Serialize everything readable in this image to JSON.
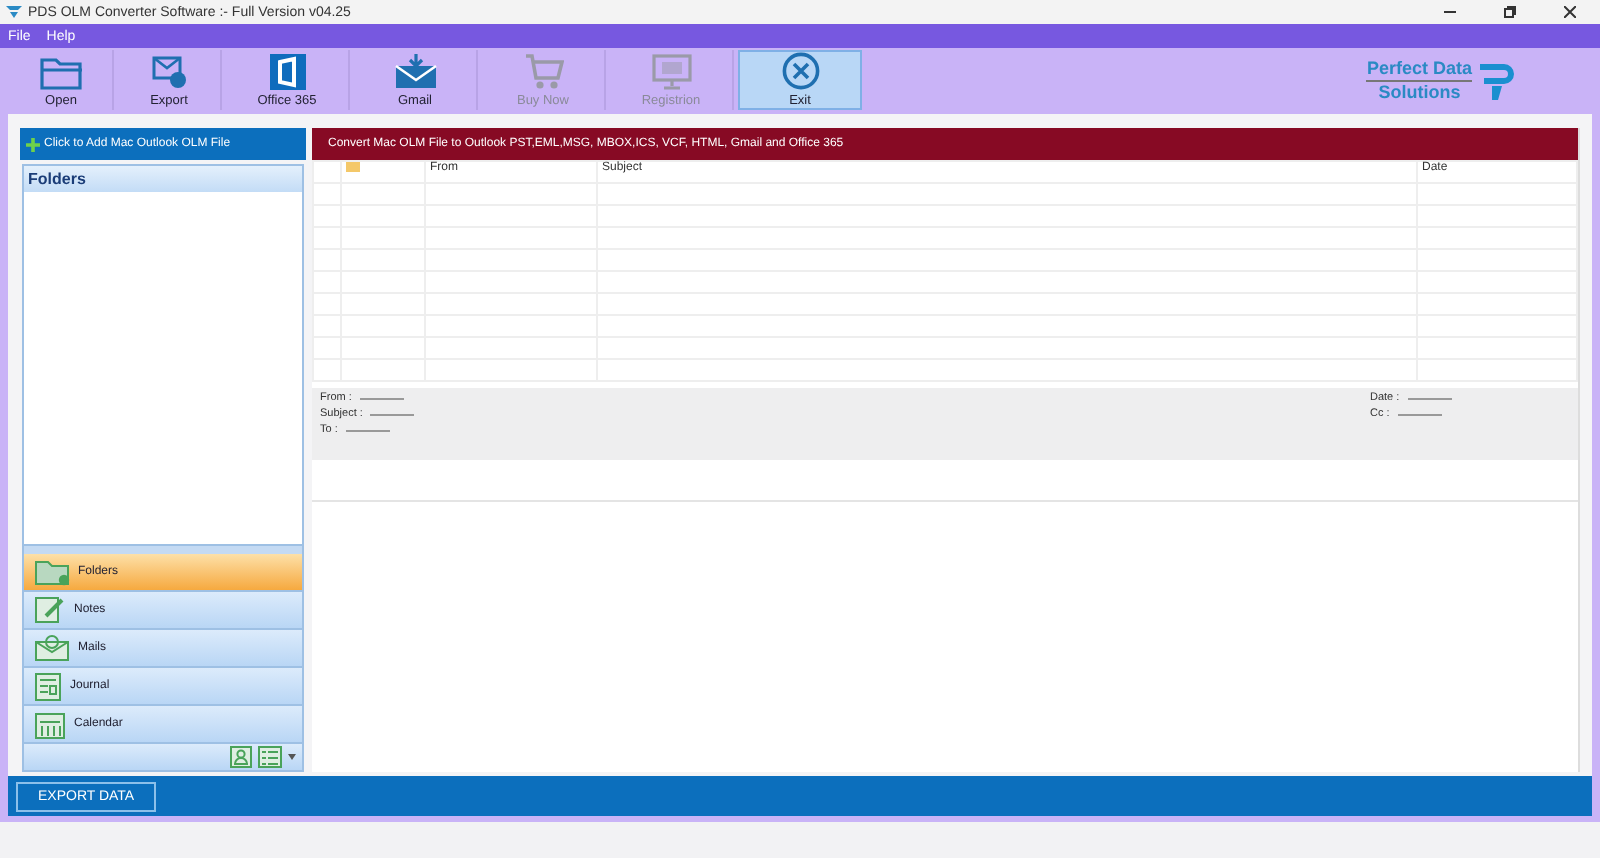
{
  "window": {
    "title": "PDS OLM Converter Software :- Full Version v04.25"
  },
  "menu": [
    "File",
    "Help"
  ],
  "toolbar": [
    {
      "label": "Open",
      "kind": "open",
      "disabled": false,
      "selected": false
    },
    {
      "label": "Export",
      "kind": "export",
      "disabled": false,
      "selected": false
    },
    {
      "label": "Office 365",
      "kind": "office",
      "disabled": false,
      "selected": false
    },
    {
      "label": "Gmail",
      "kind": "gmail",
      "disabled": false,
      "selected": false
    },
    {
      "label": "Buy Now",
      "kind": "cart",
      "disabled": true,
      "selected": false
    },
    {
      "label": "Registrion",
      "kind": "monitor",
      "disabled": true,
      "selected": false
    },
    {
      "label": "Exit",
      "kind": "exit",
      "disabled": false,
      "selected": true
    }
  ],
  "logo": {
    "line1": "Perfect Data",
    "line2": "Solutions"
  },
  "add_file_button": "Click to Add Mac Outlook OLM File",
  "folders_header": "Folders",
  "nav": [
    {
      "label": "Folders",
      "kind": "folder",
      "selected": true
    },
    {
      "label": "Notes",
      "kind": "notes",
      "selected": false
    },
    {
      "label": "Mails",
      "kind": "mail",
      "selected": false
    },
    {
      "label": "Journal",
      "kind": "journal",
      "selected": false
    },
    {
      "label": "Calendar",
      "kind": "calendar",
      "selected": false
    }
  ],
  "banner": "Convert Mac OLM File to Outlook PST,EML,MSG, MBOX,ICS, VCF, HTML, Gmail and Office 365",
  "table": {
    "columns": [
      "From",
      "Subject",
      "Date"
    ]
  },
  "preview": {
    "left": [
      "From :",
      "Subject :",
      "To :"
    ],
    "right": [
      "Date :",
      "Cc :"
    ]
  },
  "export_button": "EXPORT DATA"
}
